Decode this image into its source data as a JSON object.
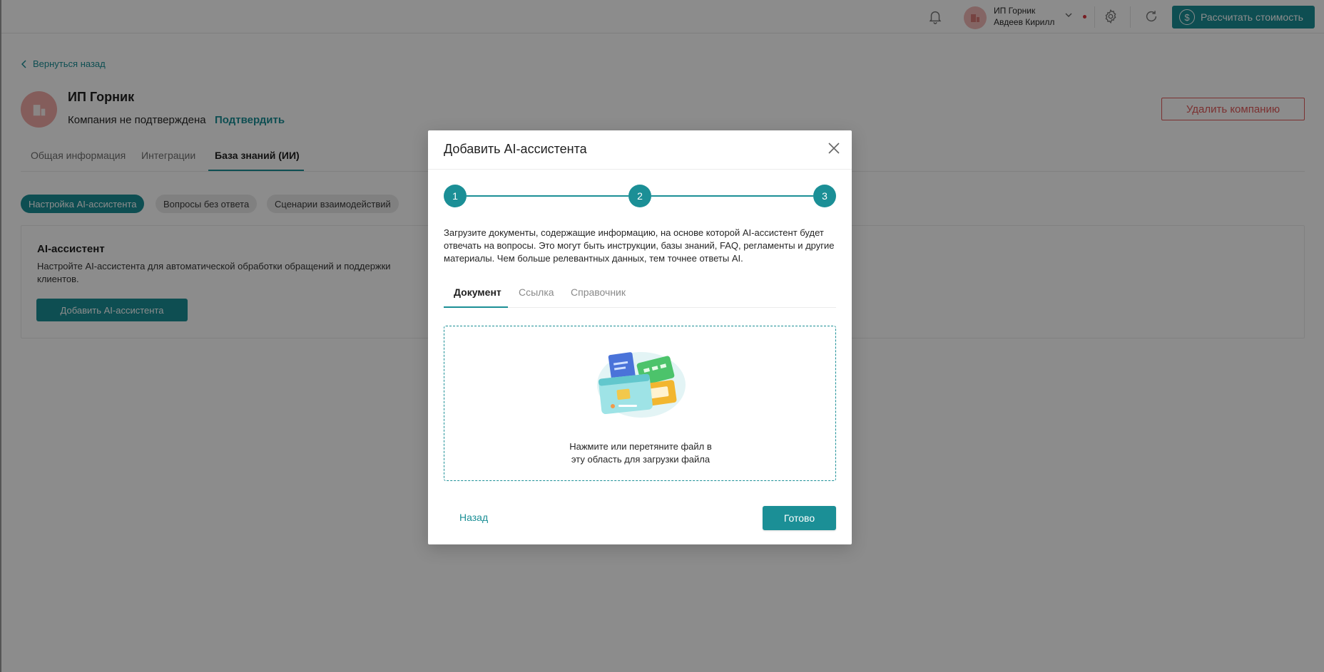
{
  "header": {
    "user_company": "ИП Горник",
    "user_name": "Авдеев Кирилл",
    "calc_button": "Рассчитать стоимость"
  },
  "page": {
    "back_link": "Вернуться назад",
    "company_name": "ИП Горник",
    "company_status": "Компания не подтверждена",
    "confirm_link": "Подтвердить",
    "delete_button": "Удалить компанию",
    "tabs": [
      {
        "label": "Общая информация"
      },
      {
        "label": "Интеграции"
      },
      {
        "label": "База знаний (ИИ)"
      }
    ],
    "chips": [
      {
        "label": "Настройка AI-ассистента"
      },
      {
        "label": "Вопросы без ответа"
      },
      {
        "label": "Сценарии взаимодействий"
      }
    ],
    "card": {
      "title": "AI-ассистент",
      "description": "Настройте AI-ассистента для автоматической обработки обращений и поддержки клиентов.",
      "add_button": "Добавить AI-ассистента"
    }
  },
  "modal": {
    "title": "Добавить AI-ассистента",
    "steps": [
      "1",
      "2",
      "3"
    ],
    "description": "Загрузите документы, содержащие информацию, на основе которой AI-ассистент будет отвечать на вопросы. Это могут быть инструкции, базы знаний, FAQ, регламенты и другие материалы. Чем больше релевантных данных, тем точнее ответы AI.",
    "tabs": [
      {
        "label": "Документ"
      },
      {
        "label": "Ссылка"
      },
      {
        "label": "Справочник"
      }
    ],
    "dropzone_text_1": "Нажмите или перетяните файл в",
    "dropzone_text_2": "эту область для загрузки файла",
    "back_button": "Назад",
    "done_button": "Готово"
  },
  "colors": {
    "accent": "#1b8f96",
    "danger": "#e05a5a",
    "overlay": "rgba(0,0,0,0.45)"
  }
}
